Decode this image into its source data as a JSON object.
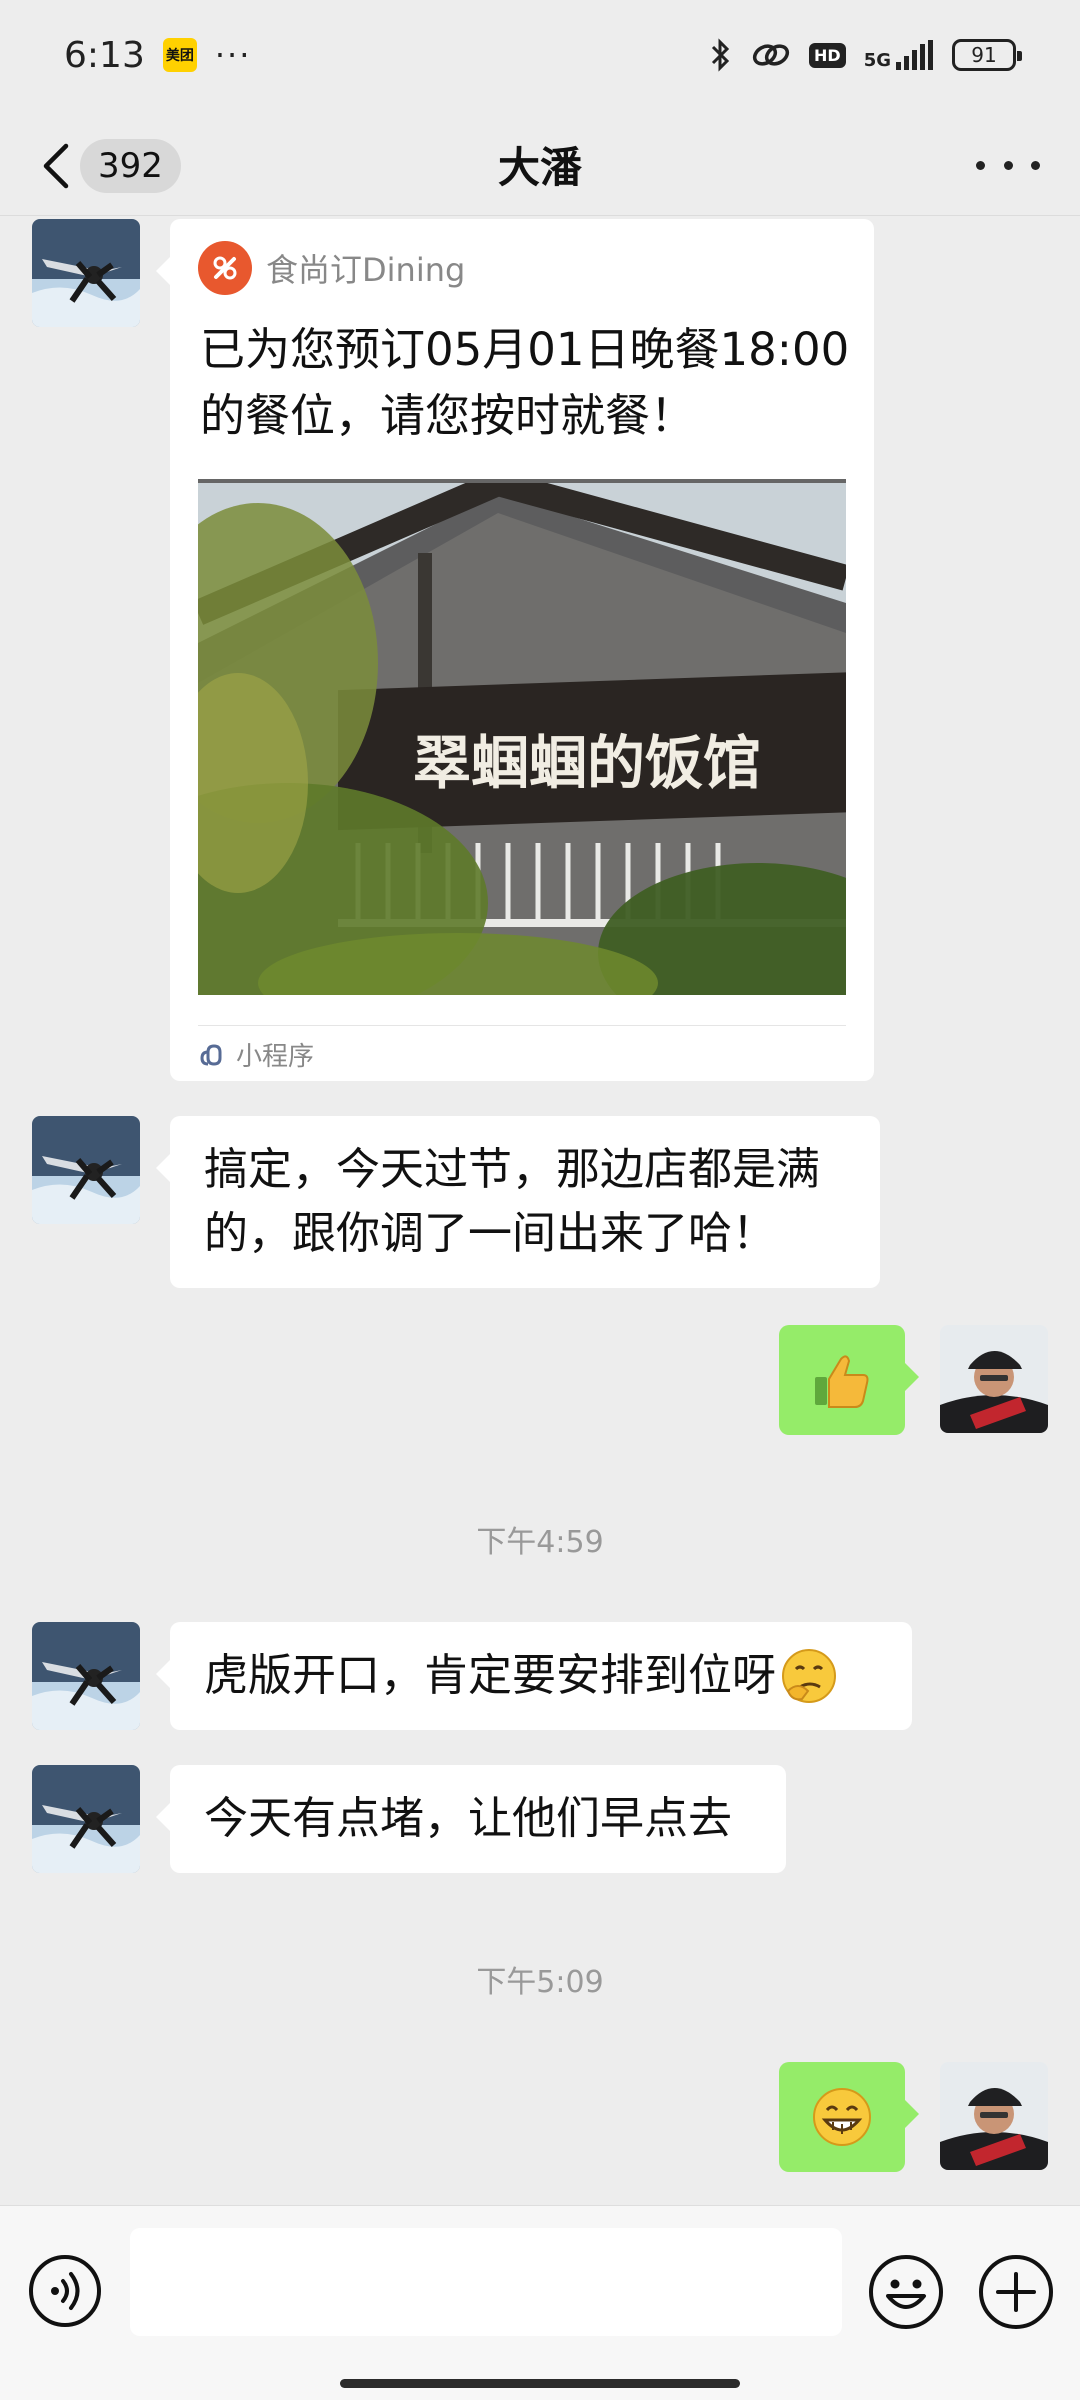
{
  "status_bar": {
    "time": "6:13",
    "meituan_app": "美团",
    "more": "···",
    "network": "5G",
    "hd": "HD",
    "battery": "91"
  },
  "nav": {
    "unread_count": "392",
    "title": "大潘"
  },
  "messages": {
    "card": {
      "source": "食尚订Dining",
      "text": "已为您预订05月01日晚餐18:00的餐位，请您按时就餐！",
      "image_sign": "翠蝈蝈的饭馆",
      "footer_label": "小程序"
    },
    "msg1": "搞定，今天过节，那边店都是满的，跟你调了一间出来了哈！",
    "time1": "下午4:59",
    "msg2": "虎版开口，肯定要安排到位呀",
    "msg3": "今天有点堵，让他们早点去",
    "time2": "下午5:09"
  },
  "colors": {
    "background": "#ededed",
    "bubble_out": "#95ec69",
    "bubble_in": "#ffffff",
    "card_logo": "#e8582e"
  }
}
